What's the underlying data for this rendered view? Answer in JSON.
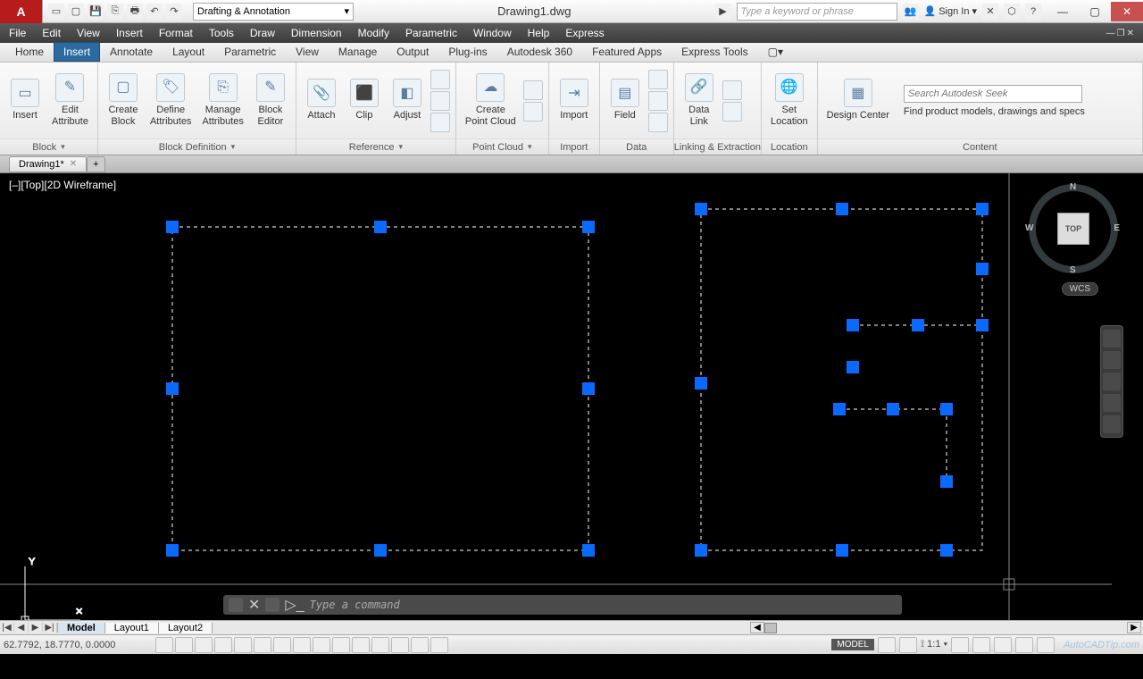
{
  "app": {
    "logo_text": "A",
    "title": "Drawing1.dwg"
  },
  "qat": {
    "workspace": "Drafting & Annotation"
  },
  "search": {
    "placeholder": "Type a keyword or phrase",
    "sign_in": "Sign In"
  },
  "menu": [
    "File",
    "Edit",
    "View",
    "Insert",
    "Format",
    "Tools",
    "Draw",
    "Dimension",
    "Modify",
    "Parametric",
    "Window",
    "Help",
    "Express"
  ],
  "ribbon_tabs": [
    "Home",
    "Insert",
    "Annotate",
    "Layout",
    "Parametric",
    "View",
    "Manage",
    "Output",
    "Plug-ins",
    "Autodesk 360",
    "Featured Apps",
    "Express Tools"
  ],
  "active_ribbon_tab": 1,
  "ribbon": {
    "block": {
      "label": "Block",
      "insert": "Insert",
      "edit_attr": "Edit\nAttribute"
    },
    "block_def": {
      "label": "Block Definition",
      "create": "Create\nBlock",
      "define": "Define\nAttributes",
      "manage": "Manage\nAttributes",
      "editor": "Block\nEditor"
    },
    "reference": {
      "label": "Reference",
      "attach": "Attach",
      "clip": "Clip",
      "adjust": "Adjust"
    },
    "point_cloud": {
      "label": "Point Cloud",
      "create": "Create\nPoint Cloud"
    },
    "import": {
      "label": "Import",
      "import": "Import"
    },
    "data": {
      "label": "Data",
      "field": "Field"
    },
    "linking": {
      "label": "Linking & Extraction",
      "data_link": "Data\nLink"
    },
    "location": {
      "label": "Location",
      "set": "Set\nLocation"
    },
    "content": {
      "label": "Content",
      "design_center": "Design Center",
      "seek_placeholder": "Search Autodesk Seek",
      "seek_tagline": "Find product models, drawings and specs"
    }
  },
  "file_tabs": {
    "active": "Drawing1*"
  },
  "viewport": {
    "label": "[–][Top][2D Wireframe]"
  },
  "viewcube": {
    "top": "TOP",
    "n": "N",
    "s": "S",
    "e": "E",
    "w": "W",
    "wcs": "WCS"
  },
  "command": {
    "placeholder": "Type a command"
  },
  "space_tabs": [
    "Model",
    "Layout1",
    "Layout2"
  ],
  "status": {
    "coords": "62.7792, 18.7770, 0.0000",
    "model": "MODEL",
    "scale": "1:1",
    "watermark": "AutoCADTip.com"
  }
}
